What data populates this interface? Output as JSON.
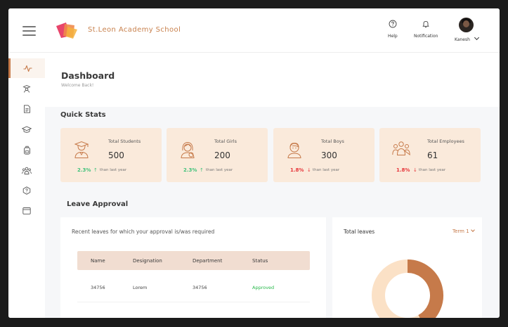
{
  "header": {
    "brand": "St.Leon Academy School",
    "help_label": "Help",
    "notification_label": "Notification",
    "user_name": "Kanesh"
  },
  "sidebar": {
    "items": [
      {
        "icon": "activity-icon",
        "active": true
      },
      {
        "icon": "teacher-icon",
        "active": false
      },
      {
        "icon": "document-icon",
        "active": false
      },
      {
        "icon": "graduation-cap-icon",
        "active": false
      },
      {
        "icon": "backpack-icon",
        "active": false
      },
      {
        "icon": "group-icon",
        "active": false
      },
      {
        "icon": "help-badge-icon",
        "active": false
      },
      {
        "icon": "calendar-icon",
        "active": false
      }
    ]
  },
  "page": {
    "title": "Dashboard",
    "subtitle": "Welcome Back!"
  },
  "quick_stats": {
    "title": "Quick Stats",
    "cards": [
      {
        "label": "Total Students",
        "value": "500",
        "change": "2.3%",
        "direction": "up",
        "comparison": "than last year",
        "icon": "graduate-icon"
      },
      {
        "label": "Total Girls",
        "value": "200",
        "change": "2.3%",
        "direction": "up",
        "comparison": "than last year",
        "icon": "girl-icon"
      },
      {
        "label": "Total Boys",
        "value": "300",
        "change": "1.8%",
        "direction": "down",
        "comparison": "than last year",
        "icon": "boy-icon"
      },
      {
        "label": "Total Employees",
        "value": "61",
        "change": "1.8%",
        "direction": "down",
        "comparison": "than last year",
        "icon": "employees-icon"
      }
    ]
  },
  "leave_approval": {
    "title": "Leave Approval",
    "description": "Recent leaves for which your approval is/was required",
    "columns": [
      "Name",
      "Designation",
      "Department",
      "Status"
    ],
    "rows": [
      {
        "name": "34756",
        "designation": "Lorem",
        "department": "34756",
        "status": "Approved"
      }
    ]
  },
  "total_leaves": {
    "title": "Total leaves",
    "term": "Term 1",
    "donut_fraction": 0.42,
    "colors": {
      "primary": "#c67a4a",
      "secondary": "#fbe1c6"
    }
  },
  "colors": {
    "accent": "#c67a4a",
    "card_bg": "#faeadb",
    "up": "#3fc27a",
    "down": "#e6353a"
  }
}
